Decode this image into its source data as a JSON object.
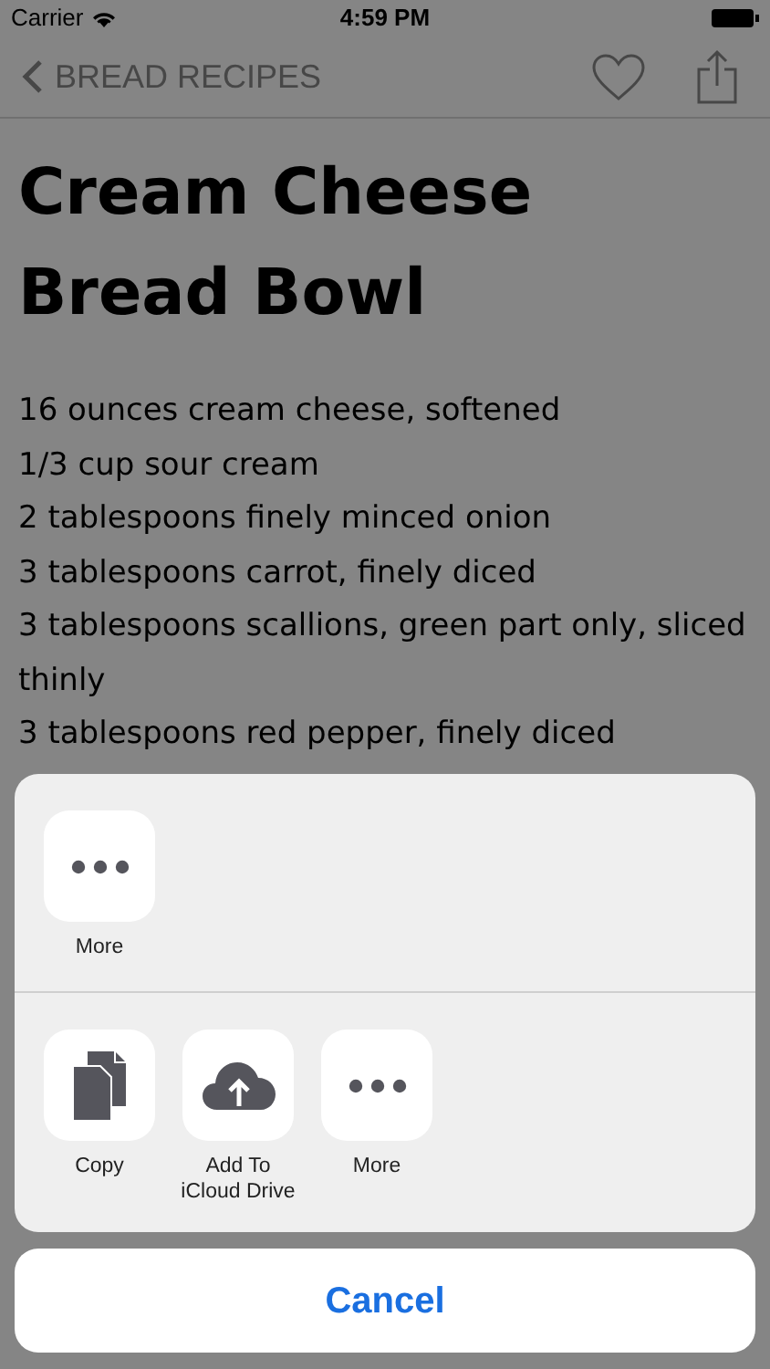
{
  "status_bar": {
    "carrier": "Carrier",
    "time": "4:59 PM"
  },
  "nav_bar": {
    "back_label": "BREAD RECIPES"
  },
  "recipe": {
    "title": "Cream Cheese Bread Bowl",
    "ingredients": [
      "16 ounces cream cheese, softened",
      "1/3 cup sour cream",
      "2 tablespoons finely minced onion",
      "3 tablespoons carrot, finely diced",
      "3 tablespoons scallions, green part only, sliced thinly",
      "3 tablespoons red pepper, finely diced"
    ]
  },
  "share_sheet": {
    "rows": [
      [
        {
          "kind": "more",
          "label_lines": [
            "More"
          ]
        }
      ],
      [
        {
          "kind": "copy",
          "label_lines": [
            "Copy"
          ]
        },
        {
          "kind": "icloud",
          "label_lines": [
            "Add To",
            "iCloud Drive"
          ]
        },
        {
          "kind": "more",
          "label_lines": [
            "More"
          ]
        }
      ]
    ],
    "cancel": "Cancel"
  }
}
